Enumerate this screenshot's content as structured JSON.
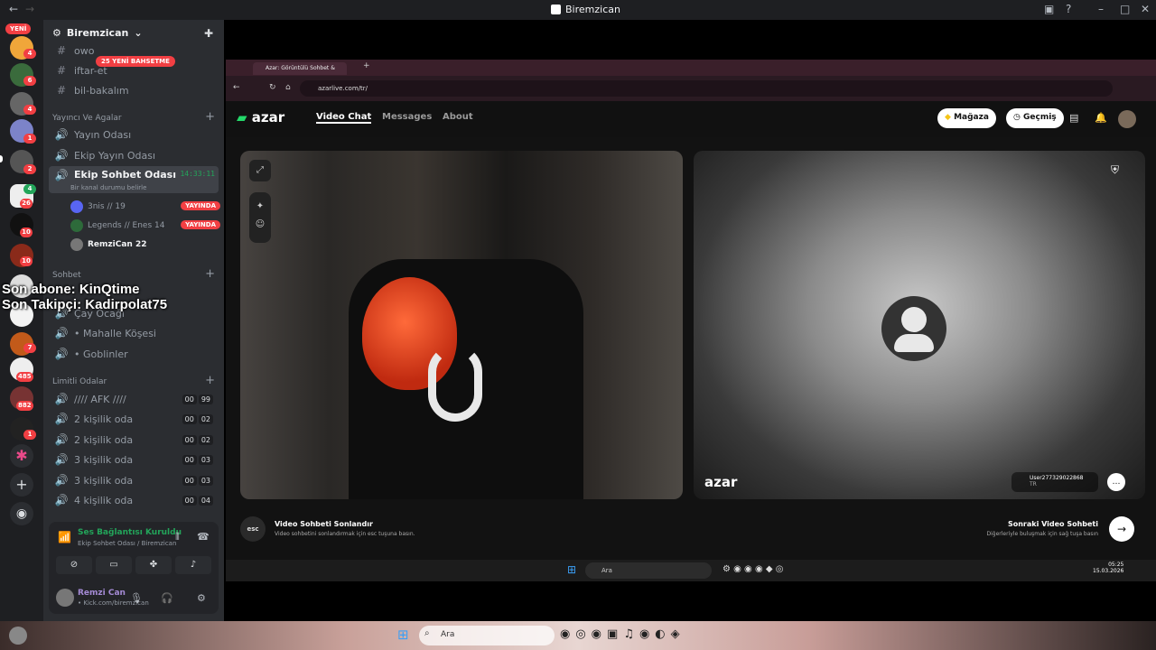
{
  "window": {
    "title": "Biremzican"
  },
  "rail": {
    "new_label": "YENİ",
    "badges": [
      "4",
      "6",
      "4",
      "1",
      "2",
      "4",
      "26",
      "10",
      "10",
      "7",
      "485",
      "882",
      "1"
    ]
  },
  "sidebar": {
    "server_name": "Biremzican",
    "mention_banner": "25 YENİ BAHSETME",
    "top_channels": [
      "owo",
      "iftar-et",
      "bil-bakalım"
    ],
    "cat1": "Yayıncı Ve Agalar",
    "cat1_channels": [
      "Yayın Odası",
      "Ekip Yayın Odası",
      "Ekip Sohbet Odası"
    ],
    "active_timer": "14:33:11",
    "active_status": "Bir kanal durumu belirle",
    "voice_users": [
      {
        "name": "3nis // 19",
        "live": "YAYINDA"
      },
      {
        "name": "Legends // Enes 14",
        "live": "YAYINDA"
      },
      {
        "name": "RemziCan 22",
        "live": ""
      }
    ],
    "cat2": "Sohbet",
    "cat2_channels": [
      "Çay Ocağı",
      "• Mahalle Köşesi",
      "• Goblinler"
    ],
    "cat3": "Limitli Odalar",
    "cat3_channels": [
      {
        "name": "//// AFK ////",
        "a": "00",
        "b": "99"
      },
      {
        "name": "2 kişilik oda",
        "a": "00",
        "b": "02"
      },
      {
        "name": "2 kişilik oda",
        "a": "00",
        "b": "02"
      },
      {
        "name": "3 kişilik oda",
        "a": "00",
        "b": "03"
      },
      {
        "name": "3 kişilik oda",
        "a": "00",
        "b": "03"
      },
      {
        "name": "4 kişilik oda",
        "a": "00",
        "b": "04"
      }
    ]
  },
  "voice_panel": {
    "status": "Ses Bağlantısı Kuruldu",
    "location": "Ekip Sohbet Odası / Biremzican",
    "user_name": "Remzi Can",
    "user_status": "• Kick.com/biremzican"
  },
  "overlay": {
    "line1": "Son abone: KinQtime",
    "line2": "Son Takipçi: Kadirpolat75"
  },
  "browser": {
    "tab_title": "Azar: Görüntülü Sohbet &",
    "url": "azarlive.com/tr/"
  },
  "azar": {
    "logo": "azar",
    "nav": [
      "Video Chat",
      "Messages",
      "About"
    ],
    "store_label": "Mağaza",
    "history_label": "Geçmiş",
    "end_key": "esc",
    "end_title": "Video Sohbeti Sonlandır",
    "end_sub": "Video sohbetini sonlandırmak için esc tuşuna basın.",
    "next_title": "Sonraki Video Sohbeti",
    "next_sub": "Diğerleriyle buluşmak için sağ tuşa basın",
    "remote_user": "User277329022868",
    "remote_country": "TR",
    "watermark": "azar"
  },
  "inner_taskbar": {
    "search": "Ara",
    "time": "05:25",
    "date": "15.03.2026"
  },
  "outer_taskbar": {
    "search": "Ara"
  },
  "colors": {
    "discord_bg": "#2b2d31",
    "rail_bg": "#1e1f22",
    "live_red": "#f23f43",
    "connected_green": "#23a55a",
    "mention_red": "#f23f43"
  }
}
